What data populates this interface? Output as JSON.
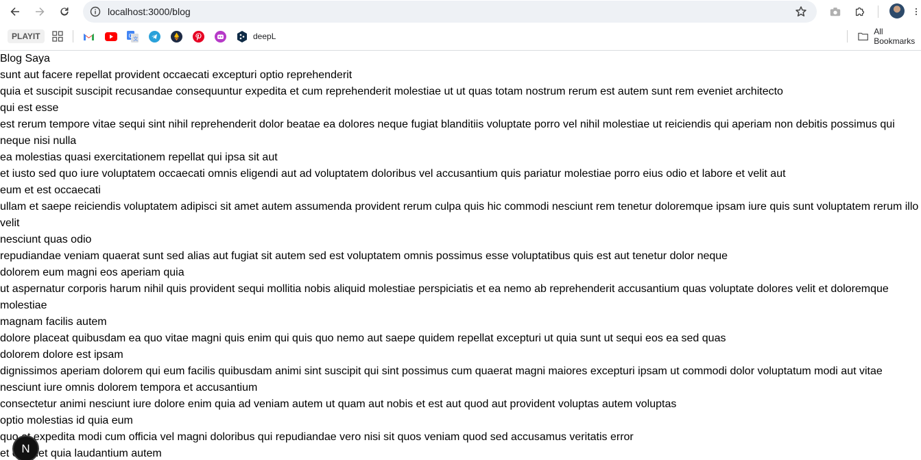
{
  "browser": {
    "url": "localhost:3000/blog",
    "bookmarks": [
      {
        "label": "PLAYIT",
        "icon": "playit-icon"
      },
      {
        "label": "",
        "icon": "apps-grid-icon"
      },
      {
        "label": "",
        "icon": "gmail-icon",
        "color": "#ea4335"
      },
      {
        "label": "",
        "icon": "youtube-icon",
        "color": "#ff0000"
      },
      {
        "label": "",
        "icon": "translate-icon",
        "color": "#4285f4"
      },
      {
        "label": "",
        "icon": "telegram-icon",
        "color": "#2aa1da"
      },
      {
        "label": "",
        "icon": "ethereum-icon",
        "color": "#1d2a44"
      },
      {
        "label": "",
        "icon": "pinterest-icon",
        "color": "#e60023"
      },
      {
        "label": "",
        "icon": "discord-like-icon",
        "color": "#b63ac8"
      },
      {
        "label": "deepL",
        "icon": "deepl-icon",
        "color": "#0f2b46"
      }
    ],
    "all_bookmarks_label": "All Bookmarks"
  },
  "page": {
    "title": "Blog Saya",
    "lines": [
      "sunt aut facere repellat provident occaecati excepturi optio reprehenderit",
      "quia et suscipit suscipit recusandae consequuntur expedita et cum reprehenderit molestiae ut ut quas totam nostrum rerum est autem sunt rem eveniet architecto",
      "qui est esse",
      "est rerum tempore vitae sequi sint nihil reprehenderit dolor beatae ea dolores neque fugiat blanditiis voluptate porro vel nihil molestiae ut reiciendis qui aperiam non debitis possimus qui neque nisi nulla",
      "ea molestias quasi exercitationem repellat qui ipsa sit aut",
      "et iusto sed quo iure voluptatem occaecati omnis eligendi aut ad voluptatem doloribus vel accusantium quis pariatur molestiae porro eius odio et labore et velit aut",
      "eum et est occaecati",
      "ullam et saepe reiciendis voluptatem adipisci sit amet autem assumenda provident rerum culpa quis hic commodi nesciunt rem tenetur doloremque ipsam iure quis sunt voluptatem rerum illo velit",
      "nesciunt quas odio",
      "repudiandae veniam quaerat sunt sed alias aut fugiat sit autem sed est voluptatem omnis possimus esse voluptatibus quis est aut tenetur dolor neque",
      "dolorem eum magni eos aperiam quia",
      "ut aspernatur corporis harum nihil quis provident sequi mollitia nobis aliquid molestiae perspiciatis et ea nemo ab reprehenderit accusantium quas voluptate dolores velit et doloremque molestiae",
      "magnam facilis autem",
      "dolore placeat quibusdam ea quo vitae magni quis enim qui quis quo nemo aut saepe quidem repellat excepturi ut quia sunt ut sequi eos ea sed quas",
      "dolorem dolore est ipsam",
      "dignissimos aperiam dolorem qui eum facilis quibusdam animi sint suscipit qui sint possimus cum quaerat magni maiores excepturi ipsam ut commodi dolor voluptatum modi aut vitae",
      "nesciunt iure omnis dolorem tempora et accusantium",
      "consectetur animi nesciunt iure dolore enim quia ad veniam autem ut quam aut nobis et est aut quod aut provident voluptas autem voluptas",
      "optio molestias id quia eum",
      "quo et expedita modi cum officia vel magni doloribus qui repudiandae vero nisi sit quos veniam quod sed accusamus veritatis error",
      "et eveniet quia laudantium autem"
    ]
  },
  "dev_badge": {
    "label": "N"
  }
}
